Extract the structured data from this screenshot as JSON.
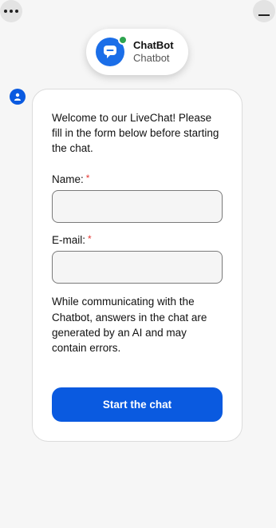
{
  "header": {
    "bot_name": "ChatBot",
    "bot_subtitle": "Chatbot",
    "menu_icon": "ellipsis-icon",
    "minimize_icon": "minimize-icon",
    "online_status_color": "#2ea44f"
  },
  "form": {
    "welcome_text": "Welcome to our LiveChat! Please fill in the form below before starting the chat.",
    "name_label": "Name:",
    "name_value": "",
    "email_label": "E-mail:",
    "email_value": "",
    "required_marker": "*",
    "disclaimer": "While communicating with the Chatbot, answers in the chat are generated by an AI and may contain errors.",
    "start_button": "Start the chat"
  },
  "colors": {
    "accent": "#0a5ae0",
    "required": "#e53935",
    "background": "#f6f6f6"
  }
}
